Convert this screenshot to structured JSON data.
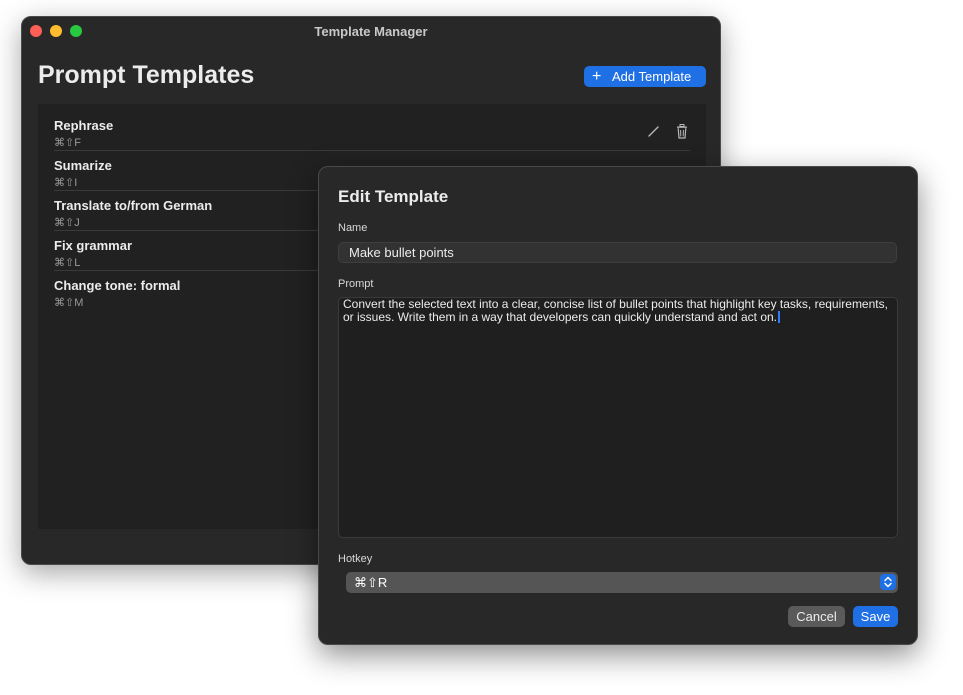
{
  "window": {
    "title": "Template Manager",
    "page_title": "Prompt Templates",
    "add_button_label": "Add Template"
  },
  "templates": [
    {
      "name": "Rephrase",
      "hotkey": "⌘⇧F"
    },
    {
      "name": "Sumarize",
      "hotkey": "⌘⇧I"
    },
    {
      "name": "Translate to/from German",
      "hotkey": "⌘⇧J"
    },
    {
      "name": "Fix grammar",
      "hotkey": "⌘⇧L"
    },
    {
      "name": "Change tone: formal",
      "hotkey": "⌘⇧M"
    }
  ],
  "editor": {
    "title": "Edit Template",
    "name_label": "Name",
    "name_value": "Make bullet points",
    "prompt_label": "Prompt",
    "prompt_value": "Convert the selected text into a clear, concise list of bullet points that highlight key tasks, requirements, or issues. Write them in a way that developers can quickly understand and act on.",
    "hotkey_label": "Hotkey",
    "hotkey_value": "⌘⇧R",
    "cancel_label": "Cancel",
    "save_label": "Save"
  },
  "colors": {
    "accent": "#1f6fe5",
    "window_bg": "#282828",
    "list_bg": "#212121"
  }
}
